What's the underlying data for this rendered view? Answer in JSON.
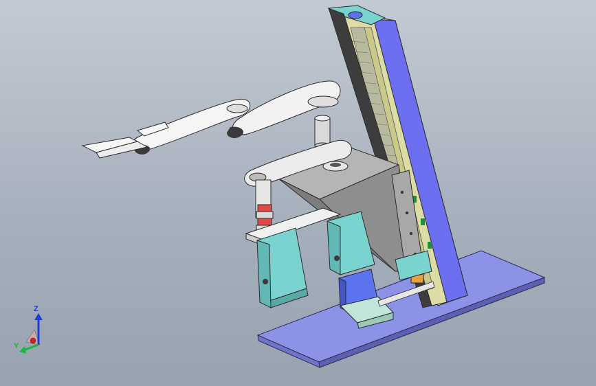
{
  "view": {
    "background_top": "#c3cad4",
    "background_bottom": "#98a2b0"
  },
  "triad": {
    "z_label": "Z",
    "y_label": "Y",
    "z_color": "#1f3bd6",
    "y_color": "#18b83a",
    "x_color": "#d42020"
  },
  "colors": {
    "base_plate": "#8c93e6",
    "rail_blue": "#6c6ff0",
    "rail_yellow": "#dcdca4",
    "arm_white": "#f2f2f2",
    "bracket_gray": "#9a9a9a",
    "motor_teal": "#7ad3cf",
    "motor_blue": "#5d74f0",
    "coupling_red": "#e04848"
  }
}
